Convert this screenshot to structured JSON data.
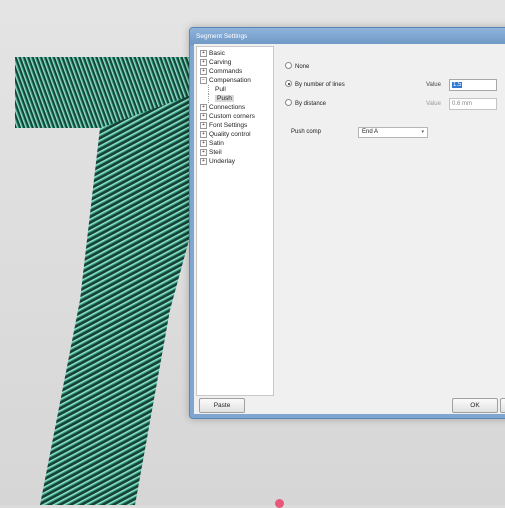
{
  "dialog": {
    "title": "Segment Settings"
  },
  "tree": {
    "items": [
      {
        "label": "Basic",
        "expander": "+",
        "level": 0
      },
      {
        "label": "Carving",
        "expander": "+",
        "level": 0
      },
      {
        "label": "Commands",
        "expander": "+",
        "level": 0
      },
      {
        "label": "Compensation",
        "expander": "−",
        "level": 0
      },
      {
        "label": "Pull",
        "expander": "",
        "level": 1
      },
      {
        "label": "Push",
        "expander": "",
        "level": 1,
        "selected": true
      },
      {
        "label": "Connections",
        "expander": "+",
        "level": 0
      },
      {
        "label": "Custom corners",
        "expander": "+",
        "level": 0
      },
      {
        "label": "Font Settings",
        "expander": "+",
        "level": 0
      },
      {
        "label": "Quality control",
        "expander": "+",
        "level": 0
      },
      {
        "label": "Satin",
        "expander": "+",
        "level": 0
      },
      {
        "label": "Steil",
        "expander": "+",
        "level": 0
      },
      {
        "label": "Underlay",
        "expander": "+",
        "level": 0
      }
    ]
  },
  "push": {
    "options": [
      {
        "label": "None",
        "checked": false
      },
      {
        "label": "By number of lines",
        "checked": true
      },
      {
        "label": "By distance",
        "checked": false
      }
    ],
    "lines_value_label": "Value",
    "lines_value": "1.5",
    "distance_value_label": "Value",
    "distance_value": "0.6 mm",
    "push_comp_label": "Push comp",
    "push_comp_value": "End A",
    "push_comp_chevron": "▾"
  },
  "buttons": {
    "paste": "Paste",
    "ok": "OK"
  },
  "colors": {
    "stitch_green": "#2f9a78",
    "stitch_dark": "#143c32",
    "dialog_frame": "#7fa6cf",
    "selection_blue": "#3379d6"
  }
}
